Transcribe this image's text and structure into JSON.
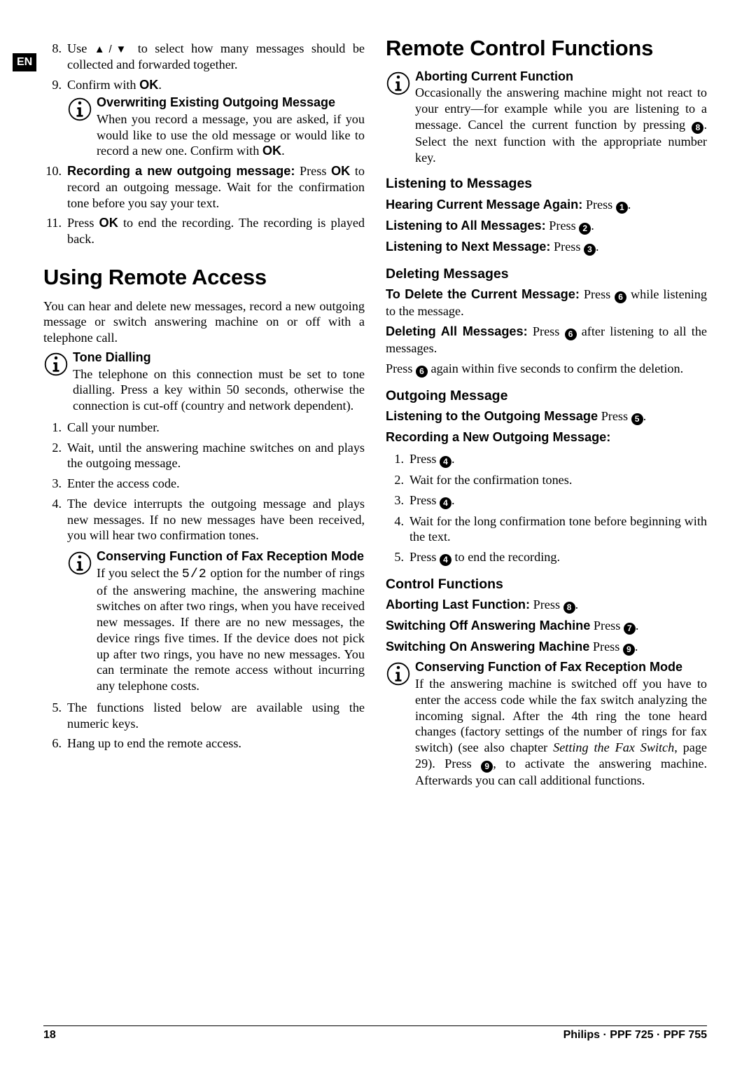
{
  "lang_tab": "EN",
  "footer": {
    "page": "18",
    "model": "Philips · PPF 725 · PPF 755"
  },
  "left": {
    "ol_continue": {
      "li8a": "Use ",
      "li8_arrows": "▲/▼",
      "li8b": " to select how many messages should be collected and forwarded together.",
      "li9a": "Confirm with ",
      "li9_ok": "OK",
      "li9c": "."
    },
    "info_overwrite": {
      "title": "Overwriting Existing Outgoing Message",
      "text_a": "When you record a message, you are asked, if you would like to use the old message or would like to record a new one. Confirm with ",
      "ok": "OK",
      "text_b": "."
    },
    "ol_continue2": {
      "li10_lead": "Recording a new outgoing message:",
      "li10_mid": " Press ",
      "li10_ok": "OK",
      "li10_rest": " to record an outgoing message. Wait for the confirmation tone before you say your text.",
      "li11a": "Press ",
      "li11_ok": "OK",
      "li11b": " to end the recording. The recording is played back."
    },
    "h1_remote": "Using Remote Access",
    "intro": "You can hear and delete new messages, record a new outgoing message or switch answering machine on or off with a telephone call.",
    "info_tone": {
      "title": "Tone Dialling",
      "text": "The telephone on this connection must be set to tone dialling. Press a key within 50 seconds, otherwise the connection is cut-off (country and network dependent)."
    },
    "steps": {
      "li1": "Call your number.",
      "li2": "Wait, until the answering machine switches on and plays the outgoing message.",
      "li3": "Enter the access code.",
      "li4": "The device interrupts the outgoing message and plays new messages. If no new messages have been received, you will hear two confirmation tones."
    },
    "info_conserve": {
      "title": "Conserving Function of Fax Reception Mode",
      "text_a": "If you select the ",
      "lcd": "5/2",
      "text_b": " option for the number of rings of the answering machine, the answering machine switches on after two rings, when you have received new messages. If there are no new messages, the device rings five times. If the device does not pick up after two rings, you have no new messages. You can terminate the remote access without incurring any telephone costs."
    },
    "steps2": {
      "li5": "The functions listed below are available using the numeric keys.",
      "li6": "Hang up to end the remote access."
    }
  },
  "right": {
    "h1": "Remote Control Functions",
    "info_abort": {
      "title": "Aborting Current Function",
      "text_a": "Occasionally the answering machine might not react to your entry—for example while you are listening to a message. Cancel the current function by pressing ",
      "key": "8",
      "text_b": ". Select the next function with the appropriate number key."
    },
    "h2_listen": "Listening to Messages",
    "listen": {
      "again_lbl": "Hearing Current Message Again:",
      "again_post": " Press ",
      "again_key": "1",
      "all_lbl": "Listening to All Messages:",
      "all_post": " Press ",
      "all_key": "2",
      "next_lbl": "Listening to Next Message:",
      "next_post": " Press ",
      "next_key": "3"
    },
    "h2_delete": "Deleting Messages",
    "delete": {
      "cur_lbl": "To Delete the Current Message:",
      "cur_post": " Press ",
      "cur_key": "6",
      "cur_tail": " while listening to the message.",
      "all_lbl": "Deleting All Messages:",
      "all_post": " Press ",
      "all_key": "6",
      "all_tail": " after listening to all the messages.",
      "confirm_a": "Press ",
      "confirm_key": "6",
      "confirm_b": " again within five seconds to confirm the deletion."
    },
    "h2_out": "Outgoing Message",
    "out": {
      "listen_lbl": "Listening to the Outgoing Message",
      "listen_post": " Press ",
      "listen_key": "5",
      "rec_lbl": "Recording a New Outgoing Message:",
      "li1a": "Press ",
      "li1_key": "4",
      "li1b": ".",
      "li2": "Wait for the confirmation tones.",
      "li3a": "Press ",
      "li3_key": "4",
      "li3b": ".",
      "li4": "Wait for the long confirmation tone before beginning with the text.",
      "li5a": "Press ",
      "li5_key": "4",
      "li5b": " to end the recording."
    },
    "h2_ctrl": "Control Functions",
    "ctrl": {
      "abort_lbl": "Aborting Last Function:",
      "abort_post": " Press ",
      "abort_key": "8",
      "off_lbl": "Switching Off Answering Machine",
      "off_post": " Press ",
      "off_key": "7",
      "on_lbl": "Switching On Answering Machine",
      "on_post": " Press ",
      "on_key": "9"
    },
    "info_conserve2": {
      "title": "Conserving Function of Fax Reception Mode",
      "text_a": "If the answering machine is switched off you have to enter the access code while the fax switch analyzing the incoming signal. After the 4th ring the tone heard changes (factory settings of the number of rings for fax switch) (see also chapter ",
      "ital": "Setting the Fax Switch",
      "text_b": ", page 29). Press ",
      "key": "9",
      "text_c": ", to activate the answering machine. Afterwards you can call additional functions."
    }
  }
}
